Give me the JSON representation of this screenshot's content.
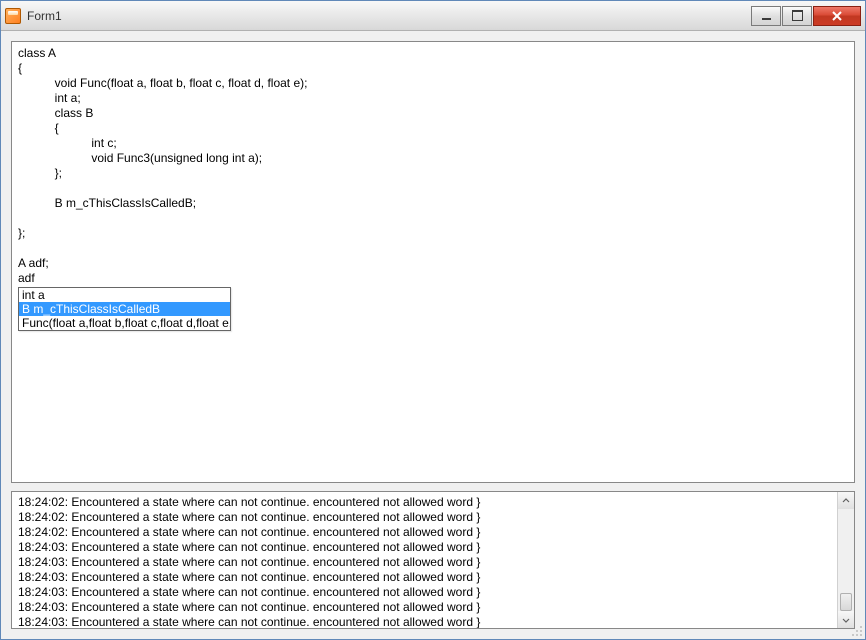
{
  "window": {
    "title": "Form1"
  },
  "editor": {
    "lines": [
      "class A",
      "{",
      "           void Func(float a, float b, float c, float d, float e);",
      "           int a;",
      "           class B",
      "           {",
      "                      int c;",
      "                      void Func3(unsigned long int a);",
      "           };",
      "",
      "           B m_cThisClassIsCalledB;",
      "",
      "};",
      "",
      "A adf;",
      "adf"
    ]
  },
  "autocomplete": {
    "items": [
      {
        "label": "int a",
        "selected": false
      },
      {
        "label": "B m_cThisClassIsCalledB",
        "selected": true
      },
      {
        "label": "Func(float a,float b,float c,float d,float e,)",
        "selected": false
      }
    ]
  },
  "log": {
    "entries": [
      {
        "time": "18:24:02",
        "msg": "Encountered a state where can not continue. encountered not allowed word }"
      },
      {
        "time": "18:24:02",
        "msg": "Encountered a state where can not continue. encountered not allowed word }"
      },
      {
        "time": "18:24:02",
        "msg": "Encountered a state where can not continue. encountered not allowed word }"
      },
      {
        "time": "18:24:03",
        "msg": "Encountered a state where can not continue. encountered not allowed word }"
      },
      {
        "time": "18:24:03",
        "msg": "Encountered a state where can not continue. encountered not allowed word }"
      },
      {
        "time": "18:24:03",
        "msg": "Encountered a state where can not continue. encountered not allowed word }"
      },
      {
        "time": "18:24:03",
        "msg": "Encountered a state where can not continue. encountered not allowed word }"
      },
      {
        "time": "18:24:03",
        "msg": "Encountered a state where can not continue. encountered not allowed word }"
      },
      {
        "time": "18:24:03",
        "msg": "Encountered a state where can not continue. encountered not allowed word }"
      }
    ]
  }
}
